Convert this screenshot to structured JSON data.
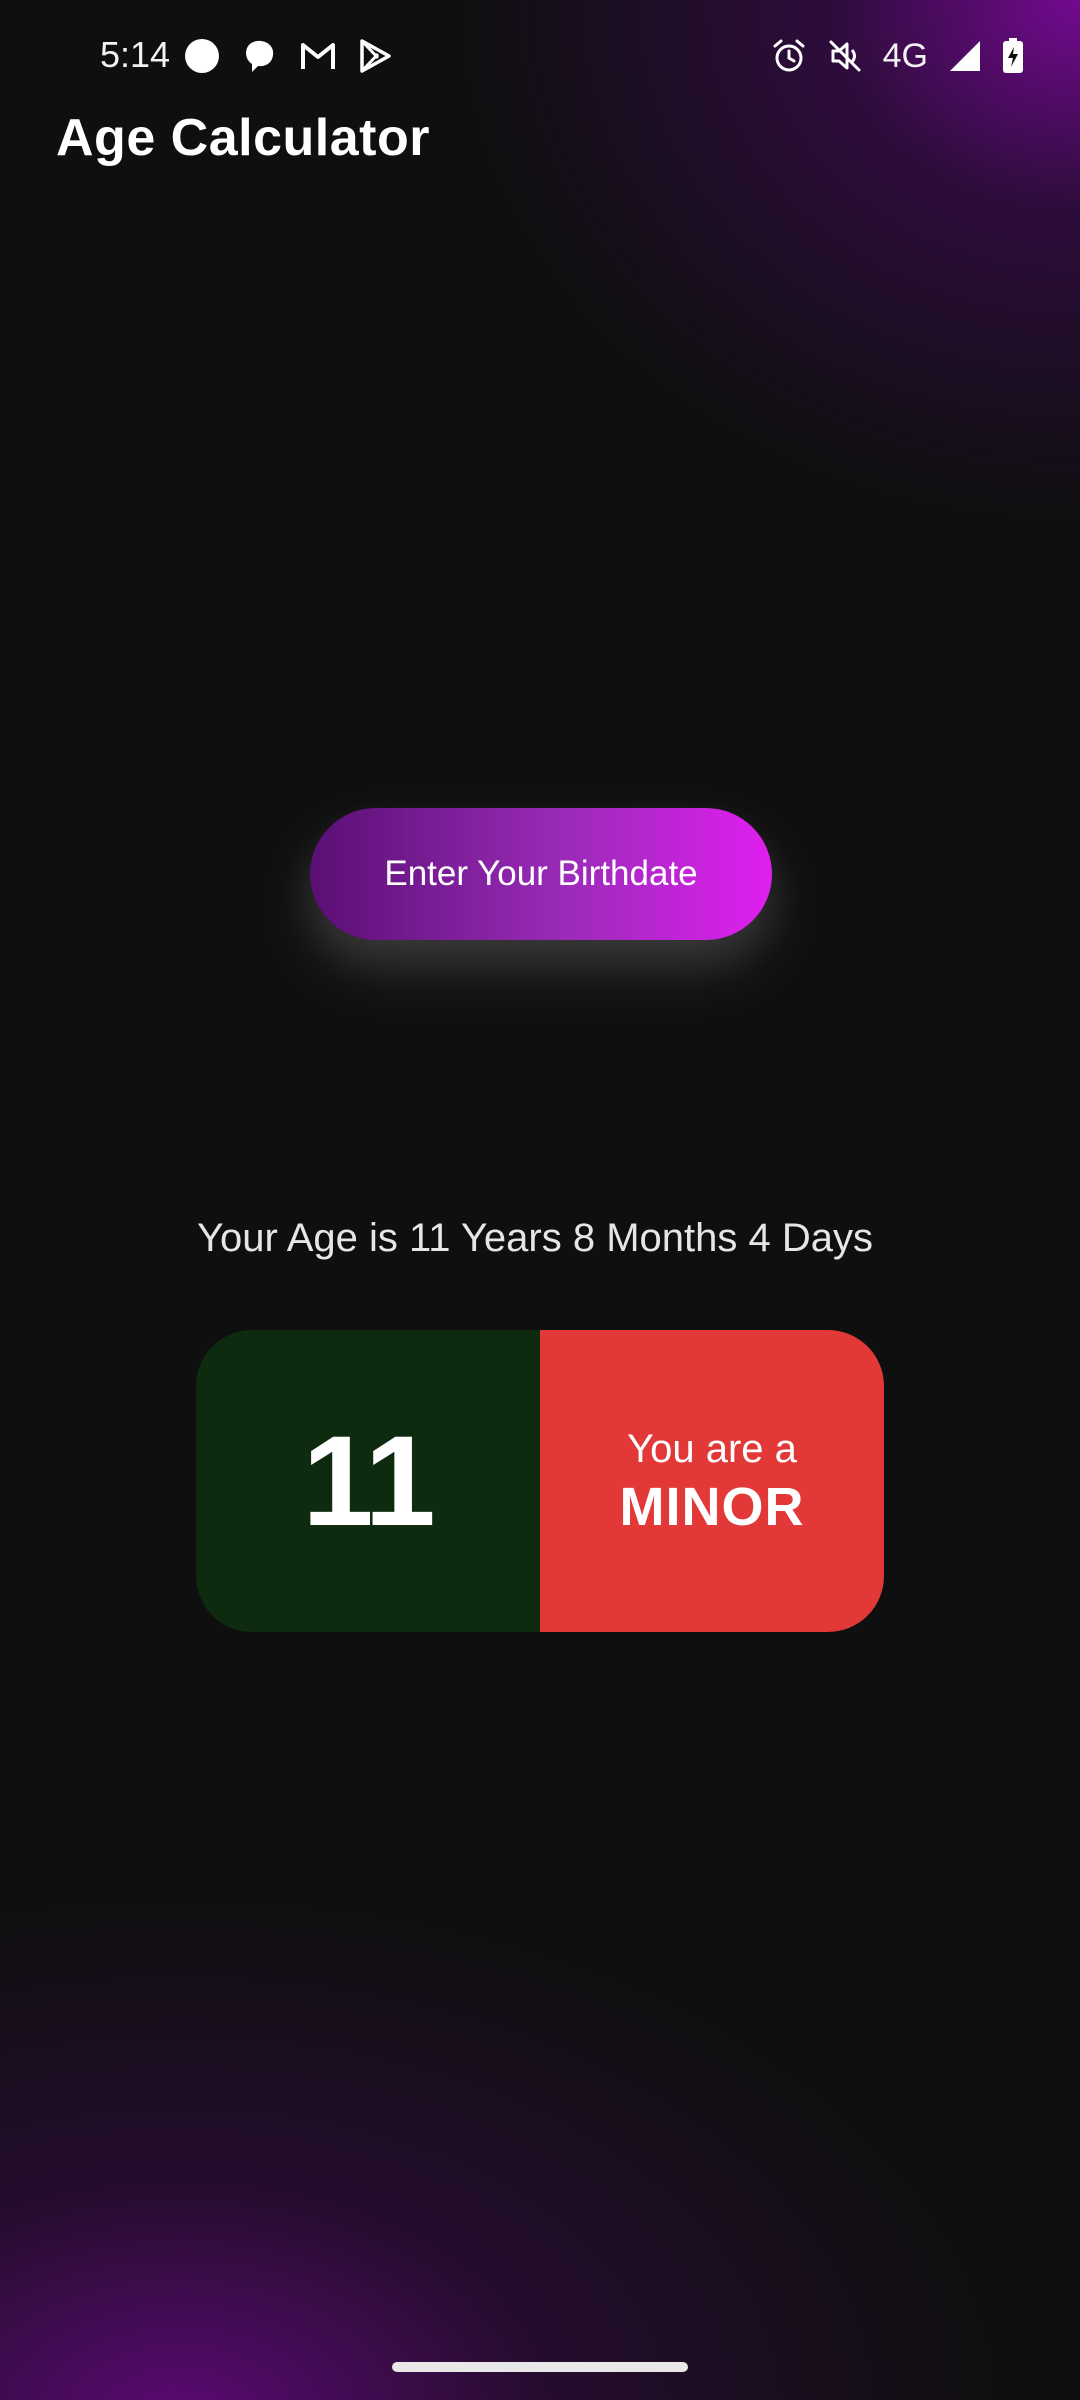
{
  "status_bar": {
    "time": "5:14",
    "network": "4G",
    "left_icons": [
      "circle-notification-icon",
      "chat-bubble-icon",
      "gmail-icon",
      "play-store-icon"
    ],
    "right_icons": [
      "alarm-icon",
      "mute-icon",
      "signal-icon",
      "battery-charging-icon"
    ]
  },
  "app": {
    "title": "Age Calculator"
  },
  "main": {
    "button_label": "Enter Your Birthdate",
    "age_text": "Your Age is 11 Years 8 Months 4 Days",
    "result": {
      "age": "11",
      "line1": "You are a",
      "line2": "MINOR"
    }
  },
  "colors": {
    "background": "#0f0f10",
    "purple_glow": "#7a0a96",
    "button_start": "#5a0f74",
    "button_end": "#e01ff0",
    "age_panel": "#0e2a0f",
    "status_panel": "#e23838"
  }
}
